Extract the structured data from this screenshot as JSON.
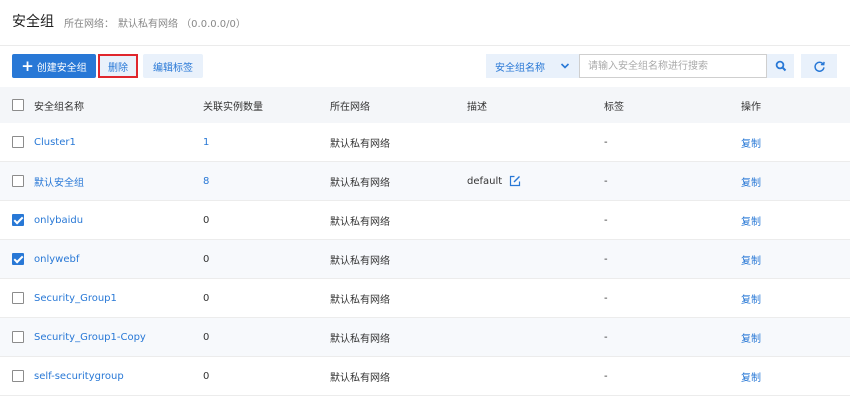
{
  "header": {
    "title": "安全组",
    "network_label": "所在网络：",
    "network_value": "默认私有网络 （0.0.0.0/0）"
  },
  "toolbar": {
    "create_label": "创建安全组",
    "create_plus": "+",
    "delete_label": "删除",
    "edit_tags_label": "编辑标签",
    "search_field_selected": "安全组名称",
    "search_placeholder": "请输入安全组名称进行搜索",
    "search_value": ""
  },
  "colors": {
    "accent": "#2878d6",
    "delete_outline": "#e0262d",
    "button_bg": "#e9f1fb"
  },
  "icons": {
    "search": "search-icon",
    "refresh": "refresh-icon",
    "chevron": "chevron-down-icon",
    "edit": "edit-icon"
  },
  "table": {
    "columns": [
      "安全组名称",
      "关联实例数量",
      "所在网络",
      "描述",
      "标签",
      "操作"
    ],
    "rows": [
      {
        "name": "Cluster1",
        "count": "1",
        "network": "默认私有网络",
        "description": "",
        "tags": "-",
        "action": "复制",
        "checked": false
      },
      {
        "name": "默认安全组",
        "count": "8",
        "network": "默认私有网络",
        "description": "default",
        "tags": "-",
        "action": "复制",
        "checked": false
      },
      {
        "name": "onlybaidu",
        "count": "0",
        "network": "默认私有网络",
        "description": "",
        "tags": "-",
        "action": "复制",
        "checked": true
      },
      {
        "name": "onlywebf",
        "count": "0",
        "network": "默认私有网络",
        "description": "",
        "tags": "-",
        "action": "复制",
        "checked": true
      },
      {
        "name": "Security_Group1",
        "count": "0",
        "network": "默认私有网络",
        "description": "",
        "tags": "-",
        "action": "复制",
        "checked": false
      },
      {
        "name": "Security_Group1-Copy",
        "count": "0",
        "network": "默认私有网络",
        "description": "",
        "tags": "-",
        "action": "复制",
        "checked": false
      },
      {
        "name": "self-securitygroup",
        "count": "0",
        "network": "默认私有网络",
        "description": "",
        "tags": "-",
        "action": "复制",
        "checked": false
      }
    ]
  }
}
